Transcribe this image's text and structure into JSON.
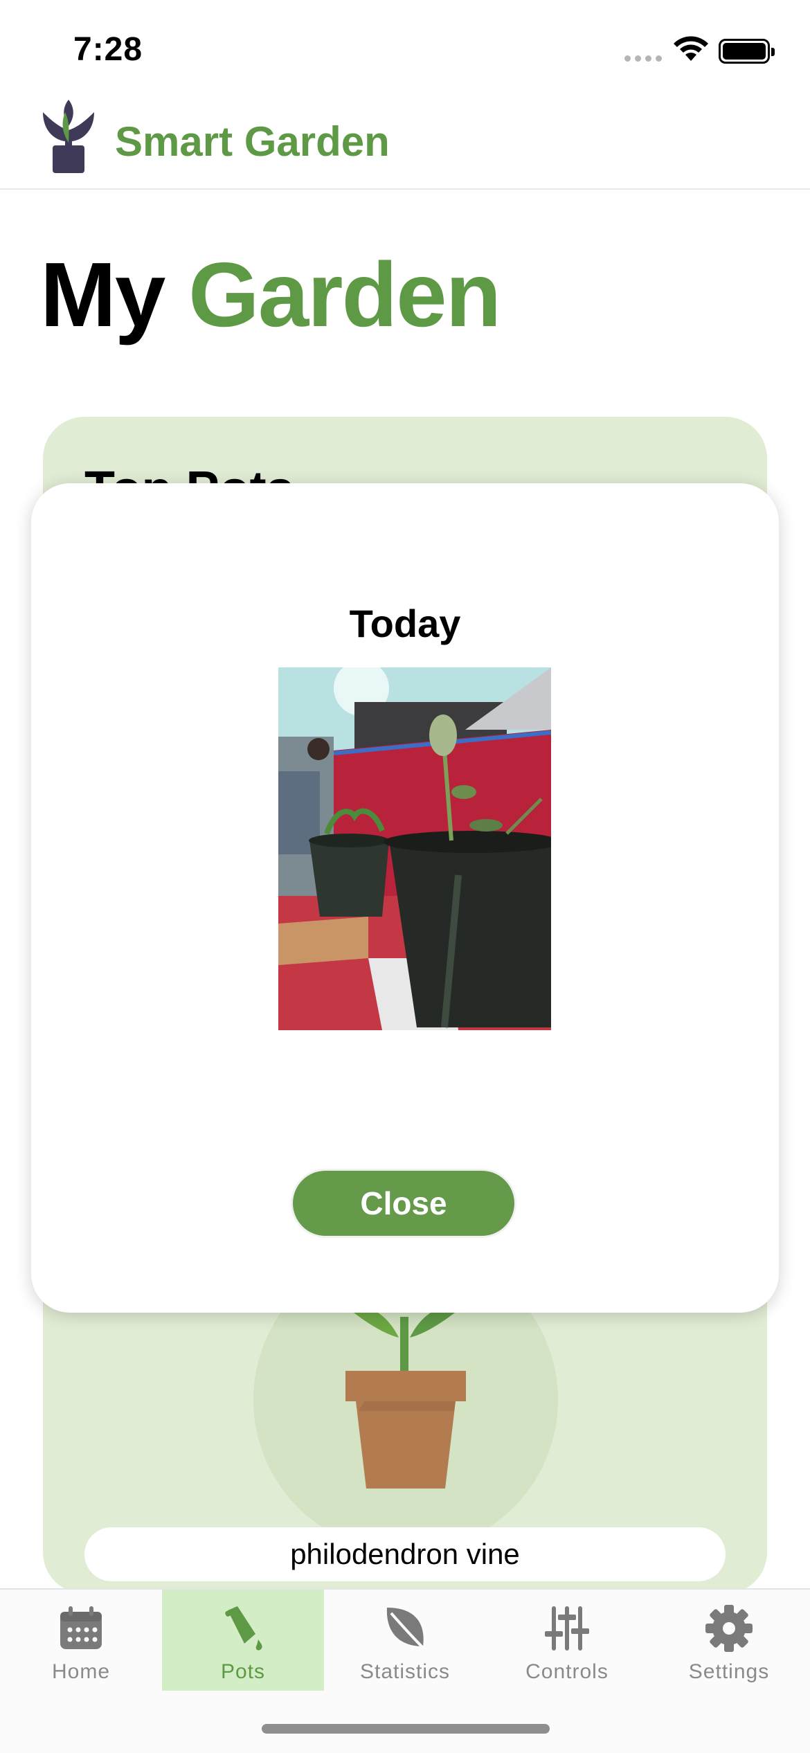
{
  "status_bar": {
    "time": "7:28"
  },
  "header": {
    "app_title": "Smart Garden"
  },
  "page": {
    "title_part1": "My",
    "title_part2": "Garden"
  },
  "card": {
    "heading": "Top Pots",
    "plant_name": "philodendron vine"
  },
  "modal": {
    "title": "Today",
    "close_label": "Close"
  },
  "tabs": [
    {
      "label": "Home",
      "icon": "calendar-icon",
      "active": false
    },
    {
      "label": "Pots",
      "icon": "watering-can-icon",
      "active": true
    },
    {
      "label": "Statistics",
      "icon": "leaf-icon",
      "active": false
    },
    {
      "label": "Controls",
      "icon": "sliders-icon",
      "active": false
    },
    {
      "label": "Settings",
      "icon": "gear-icon",
      "active": false
    }
  ],
  "colors": {
    "brand_green": "#5e9a45",
    "card_bg": "#e1ecd4",
    "active_tab_bg": "#d3eec6",
    "button_green": "#649a4a"
  }
}
